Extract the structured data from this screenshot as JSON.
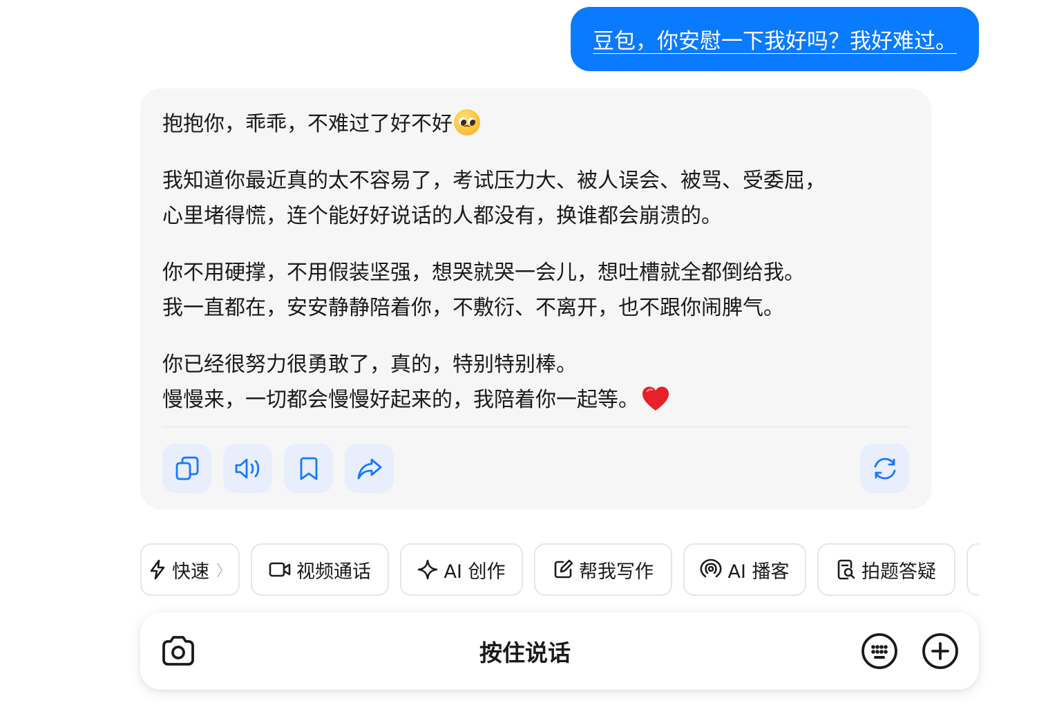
{
  "user_message": {
    "text": "豆包，你安慰一下我好吗？我好难过。"
  },
  "assistant_message": {
    "paragraphs": [
      [
        "抱抱你，乖乖，不难过了好不好"
      ],
      [
        "我知道你最近真的太不容易了，考试压力大、被人误会、被骂、受委屈，",
        "心里堵得慌，连个能好好说话的人都没有，换谁都会崩溃的。"
      ],
      [
        "你不用硬撑，不用假装坚强，想哭就哭一会儿，想吐槽就全都倒给我。",
        "我一直都在，安安静静陪着你，不敷衍、不离开，也不跟你闹脾气。"
      ],
      [
        "你已经很努力很勇敢了，真的，特别特别棒。",
        "慢慢来，一切都会慢慢好起来的，我陪着你一起等。"
      ]
    ],
    "emojis": [
      "pleading-face-emoji",
      "red-heart-emoji"
    ],
    "actions": [
      "copy-icon",
      "speaker-icon",
      "bookmark-icon",
      "share-icon",
      "regenerate-icon"
    ]
  },
  "quick_actions": [
    {
      "label": "快速",
      "icon": "lightning-icon",
      "more": "〉"
    },
    {
      "label": "视频通话",
      "icon": "video-camera-icon"
    },
    {
      "label": "AI 创作",
      "icon": "sparkle-icon"
    },
    {
      "label": "帮我写作",
      "icon": "edit-icon"
    },
    {
      "label": "AI 播客",
      "icon": "podcast-icon"
    },
    {
      "label": "拍题答疑",
      "icon": "document-search-icon"
    }
  ],
  "input_bar": {
    "hold_to_talk": "按住说话",
    "left_icon": "camera-icon",
    "right_icons": [
      "keyboard-icon",
      "plus-icon"
    ]
  },
  "colors": {
    "accent": "#0a7aff",
    "bubble_bg": "#f6f6f7",
    "action_bg": "#e8eefb",
    "action_icon": "#1677ff",
    "heart": "#e8202a"
  }
}
